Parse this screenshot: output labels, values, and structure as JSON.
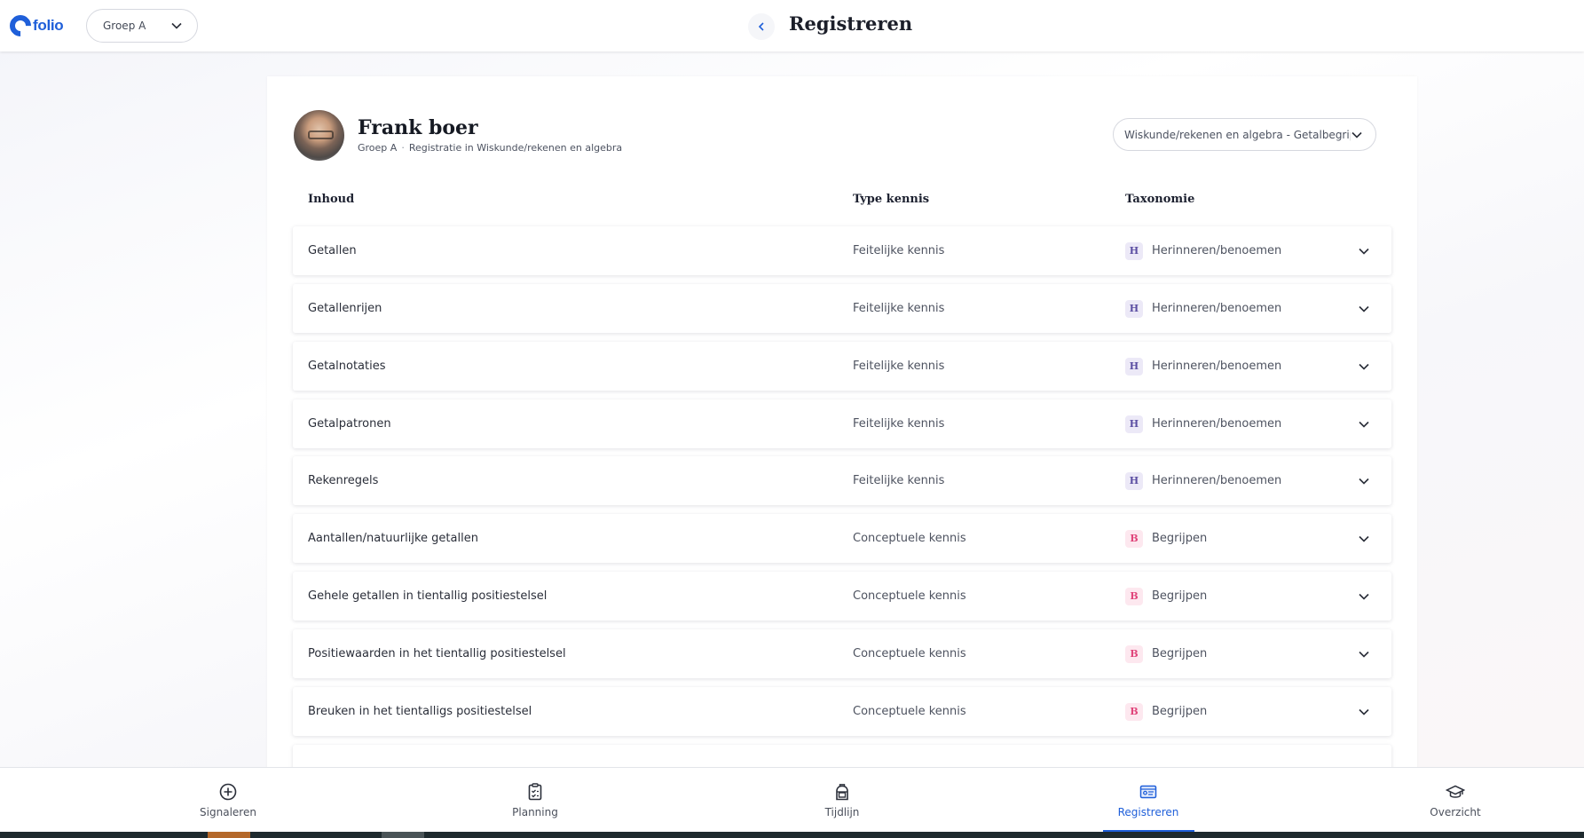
{
  "header": {
    "logo_text": "folio",
    "group_select": "Groep A",
    "title": "Registreren"
  },
  "student": {
    "name": "Frank boer",
    "group": "Groep A",
    "separator": "·",
    "registration": "Registratie in Wiskunde/rekenen en algebra"
  },
  "subject_select": "Wiskunde/rekenen en algebra - Getalbegrip",
  "columns": {
    "content": "Inhoud",
    "type": "Type kennis",
    "taxonomy": "Taxonomie"
  },
  "rows": [
    {
      "content": "Getallen",
      "type": "Feitelijke kennis",
      "badge": "H",
      "taxonomy": "Herinneren/benoemen"
    },
    {
      "content": "Getallenrijen",
      "type": "Feitelijke kennis",
      "badge": "H",
      "taxonomy": "Herinneren/benoemen"
    },
    {
      "content": "Getalnotaties",
      "type": "Feitelijke kennis",
      "badge": "H",
      "taxonomy": "Herinneren/benoemen"
    },
    {
      "content": "Getalpatronen",
      "type": "Feitelijke kennis",
      "badge": "H",
      "taxonomy": "Herinneren/benoemen"
    },
    {
      "content": "Rekenregels",
      "type": "Feitelijke kennis",
      "badge": "H",
      "taxonomy": "Herinneren/benoemen"
    },
    {
      "content": "Aantallen/natuurlijke getallen",
      "type": "Conceptuele kennis",
      "badge": "B",
      "taxonomy": "Begrijpen"
    },
    {
      "content": "Gehele getallen in tientallig positiestelsel",
      "type": "Conceptuele kennis",
      "badge": "B",
      "taxonomy": "Begrijpen"
    },
    {
      "content": "Positiewaarden in het tientallig positiestelsel",
      "type": "Conceptuele kennis",
      "badge": "B",
      "taxonomy": "Begrijpen"
    },
    {
      "content": "Breuken in het tientalligs positiestelsel",
      "type": "Conceptuele kennis",
      "badge": "B",
      "taxonomy": "Begrijpen"
    }
  ],
  "colors": {
    "accent": "#1f5fd9",
    "badge_h_bg": "#ece9f7",
    "badge_h_fg": "#5b4ea2",
    "badge_b_bg": "#fde8ef",
    "badge_b_fg": "#e0447a"
  },
  "bottom_nav": [
    {
      "label": "Signaleren",
      "icon": "plus-circle-icon",
      "active": false
    },
    {
      "label": "Planning",
      "icon": "clipboard-check-icon",
      "active": false
    },
    {
      "label": "Tijdlijn",
      "icon": "backpack-icon",
      "active": false
    },
    {
      "label": "Registreren",
      "icon": "id-card-icon",
      "active": true
    },
    {
      "label": "Overzicht",
      "icon": "graduation-cap-icon",
      "active": false
    }
  ]
}
